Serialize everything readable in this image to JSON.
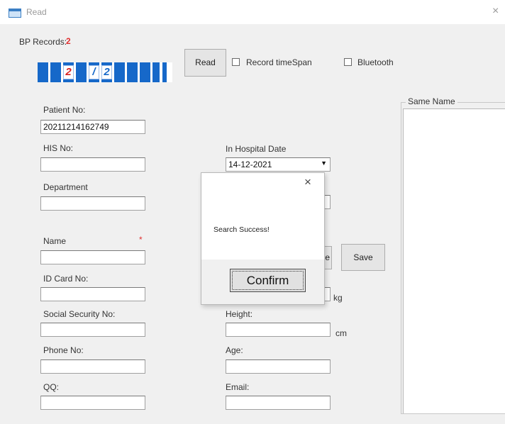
{
  "window": {
    "title": "Read",
    "close_glyph": "×",
    "icon": "window-app-icon"
  },
  "bp_records": {
    "label": "BP Records:",
    "count": "2",
    "digits": [
      "2",
      "/",
      "2"
    ]
  },
  "toolbar": {
    "read_label": "Read",
    "record_timespan_label": "Record timeSpan",
    "bluetooth_label": "Bluetooth"
  },
  "form": {
    "patient_no_label": "Patient No:",
    "patient_no_value": "20211214162749",
    "his_no_label": "HIS No:",
    "department_label": "Department",
    "name_label": "Name",
    "name_required": "*",
    "id_card_label": "ID Card No:",
    "social_security_label": "Social Security No:",
    "phone_label": "Phone No:",
    "qq_label": "QQ:",
    "in_hospital_date_label": "In Hospital Date",
    "in_hospital_date_value": "14-12-2021",
    "weight_unit": "kg",
    "height_label": "Height:",
    "height_unit": "cm",
    "age_label": "Age:",
    "email_label": "Email:",
    "save_label": "Save",
    "hidden_button_tail": "e"
  },
  "same_name": {
    "legend": "Same Name"
  },
  "dialog": {
    "close_glyph": "×",
    "message": "Search Success!",
    "confirm_label": "Confirm"
  },
  "colors": {
    "segment_blue": "#1668c9",
    "required_red": "#e03030",
    "client_bg": "#f0f0f0"
  }
}
